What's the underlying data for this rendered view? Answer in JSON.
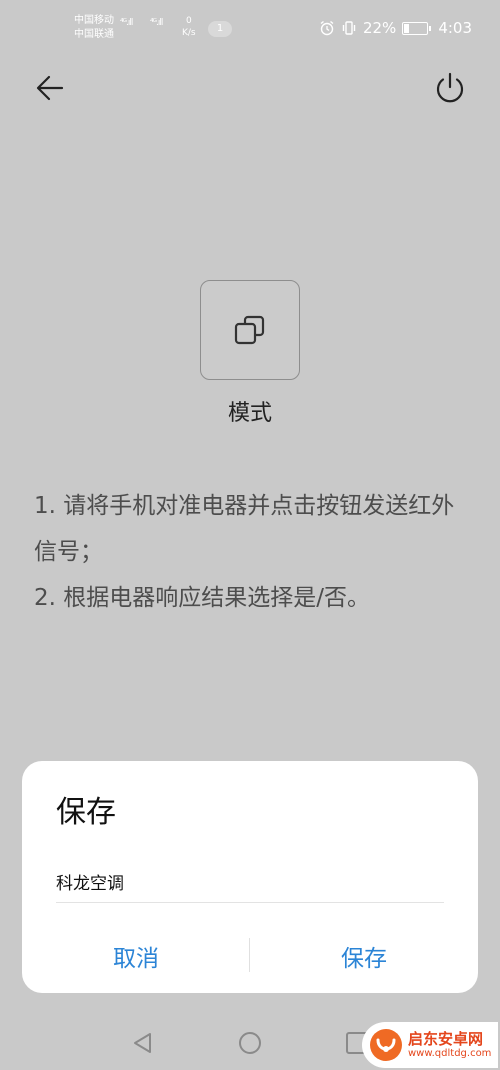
{
  "status_bar": {
    "carrier_1": "中国移动",
    "carrier_2": "中国联通",
    "signal_1": "⁴ᴳ.ıll",
    "signal_2": "⁴ᴳ.ıll",
    "speed_value": "0",
    "speed_unit": "K/s",
    "notification_count": "1",
    "battery_percent": "22%",
    "battery_level": 0.22,
    "time": "4:03"
  },
  "mode": {
    "label": "模式"
  },
  "instructions": {
    "line_1": "1. 请将手机对准电器并点击按钮发送红外信号；",
    "line_2": "2. 根据电器响应结果选择是/否。"
  },
  "dialog": {
    "title": "保存",
    "name_value": "科龙空调",
    "cancel_label": "取消",
    "save_label": "保存"
  },
  "watermark": {
    "title": "启东安卓网",
    "url": "www.qdltdg.com"
  },
  "colors": {
    "accent": "#2b84d6",
    "backdrop": "#c9c9c9"
  }
}
